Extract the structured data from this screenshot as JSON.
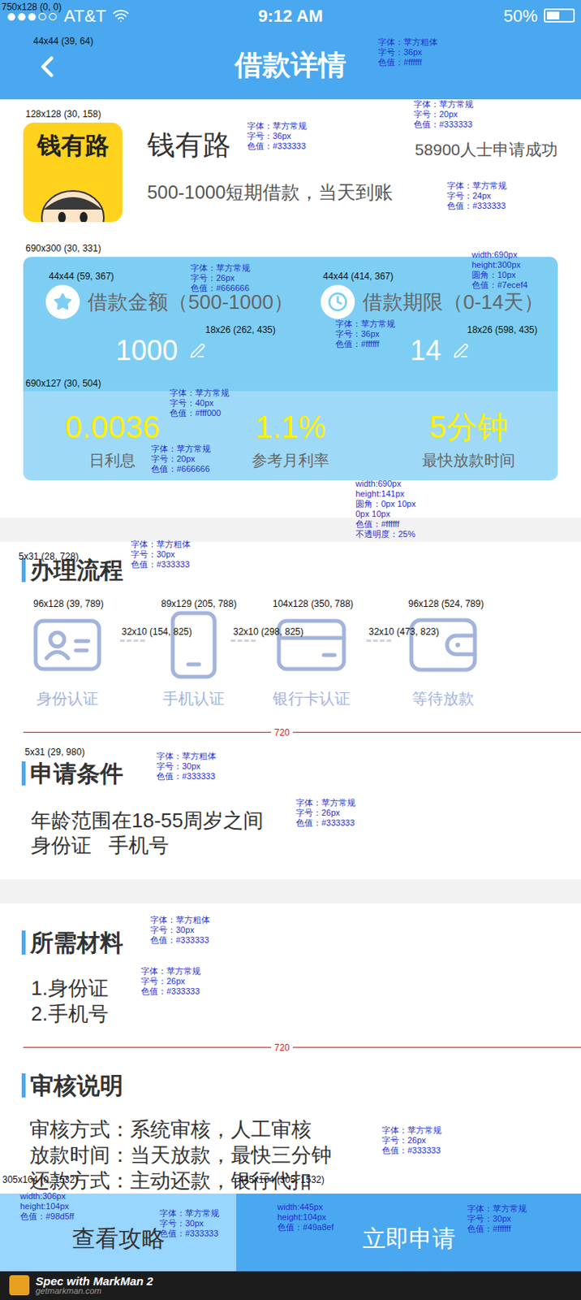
{
  "status_bar": {
    "signal": "●●●○○",
    "carrier": "AT&T",
    "time": "9:12 AM",
    "battery": "50%",
    "battery_level": 0.5
  },
  "nav": {
    "title": "借款详情"
  },
  "product": {
    "logo_text": "钱有路",
    "name": "钱有路",
    "applicants": "58900人士申请成功",
    "tagline": "500-1000短期借款，当天到账"
  },
  "loan_card": {
    "fields": [
      {
        "label": "借款金额（500-1000）",
        "value": "1000",
        "kind": "amount"
      },
      {
        "label": "借款期限（0-14天）",
        "value": "14",
        "kind": "term"
      }
    ],
    "stats": [
      {
        "value": "0.0036",
        "label": "日利息"
      },
      {
        "value": "1.1%",
        "label": "参考月利率"
      },
      {
        "value": "5分钟",
        "label": "最快放款时间"
      }
    ]
  },
  "process": {
    "title": "办理流程",
    "steps": [
      {
        "label": "身份认证",
        "kind": "id"
      },
      {
        "label": "手机认证",
        "kind": "phone"
      },
      {
        "label": "银行卡认证",
        "kind": "card"
      },
      {
        "label": "等待放款",
        "kind": "wallet"
      }
    ]
  },
  "conditions": {
    "title": "申请条件",
    "lines": [
      "年龄范围在18-55周岁之间",
      "身份证   手机号"
    ]
  },
  "materials": {
    "title": "所需材料",
    "lines": [
      "1.身份证",
      "2.手机号"
    ]
  },
  "review": {
    "title": "审核说明",
    "lines": [
      "审核方式：系统审核，人工审核",
      "放款时间：当天放款，最快三分钟",
      "还款方式：主动还款，银行代扣"
    ]
  },
  "buttons": [
    {
      "label": "查看攻略",
      "kind": "secondary"
    },
    {
      "label": "立即申请",
      "kind": "primary"
    }
  ],
  "annotations": {
    "divider_label": "720",
    "notes": [
      [
        "字体：苹方粗体",
        "字号：36px",
        "色值：#ffffff"
      ],
      [
        "字体：苹方常规",
        "字号：36px",
        "色值：#333333"
      ],
      [
        "字体：苹方常规",
        "字号：20px",
        "色值：#333333"
      ],
      [
        "字体：苹方常规",
        "字号：24px",
        "色值：#333333"
      ],
      [
        "字体：苹方常规",
        "字号：26px",
        "色值：#666666"
      ],
      [
        "width:690px",
        "height:300px",
        "圆角：10px",
        "色值：#7ecef4"
      ],
      [
        "字体：苹方常规",
        "字号：36px",
        "色值：#ffffff"
      ],
      [
        "字体：苹方常规",
        "字号：40px",
        "色值：#fff000"
      ],
      [
        "字体：苹方常规",
        "字号：20px",
        "色值：#666666"
      ],
      [
        "width:690px",
        "height:141px",
        "圆角：0px 10px",
        "0px 10px",
        "色值：#ffffff",
        "不透明度：25%"
      ],
      [
        "字体：苹方粗体",
        "字号：30px",
        "色值：#333333"
      ],
      [
        "字体：苹方粗体",
        "字号：30px",
        "色值：#333333"
      ],
      [
        "字体：苹方常规",
        "字号：26px",
        "色值：#333333"
      ],
      [
        "字体：苹方粗体",
        "字号：30px",
        "色值：#333333"
      ],
      [
        "字体：苹方常规",
        "字号：26px",
        "色值：#333333"
      ],
      [
        "字体：苹方常规",
        "字号：26px",
        "色值：#333333"
      ],
      [
        "width:306px",
        "height:104px",
        "色值：#98d5ff"
      ],
      [
        "字体：苹方常规",
        "字号：30px",
        "色值：#333333"
      ],
      [
        "width:445px",
        "height:104px",
        "色值：#49a8ef"
      ],
      [
        "字体：苹方常规",
        "字号：30px",
        "色值：#ffffff"
      ]
    ],
    "boxes": [
      "750x128 (0, 0)",
      "44x44 (39, 64)",
      "128x128 (30, 158)",
      "690x300 (30, 331)",
      "44x44 (59, 367)",
      "44x44 (414, 367)",
      "18x26 (262, 435)",
      "18x26 (598, 435)",
      "690x127 (30, 504)",
      "5x31 (28, 728)",
      "96x128 (39, 789)",
      "89x129 (205, 788)",
      "104x128 (350, 788)",
      "96x128 (524, 789)",
      "32x10 (154, 825)",
      "32x10 (298, 825)",
      "32x10 (473, 823)",
      "5x31 (29, 980)",
      "305x104 (0, 1532)",
      "445x104 (305, 1532)"
    ]
  },
  "footer": {
    "brand": "Spec with MarkMan 2",
    "url": "getmarkman.com"
  }
}
